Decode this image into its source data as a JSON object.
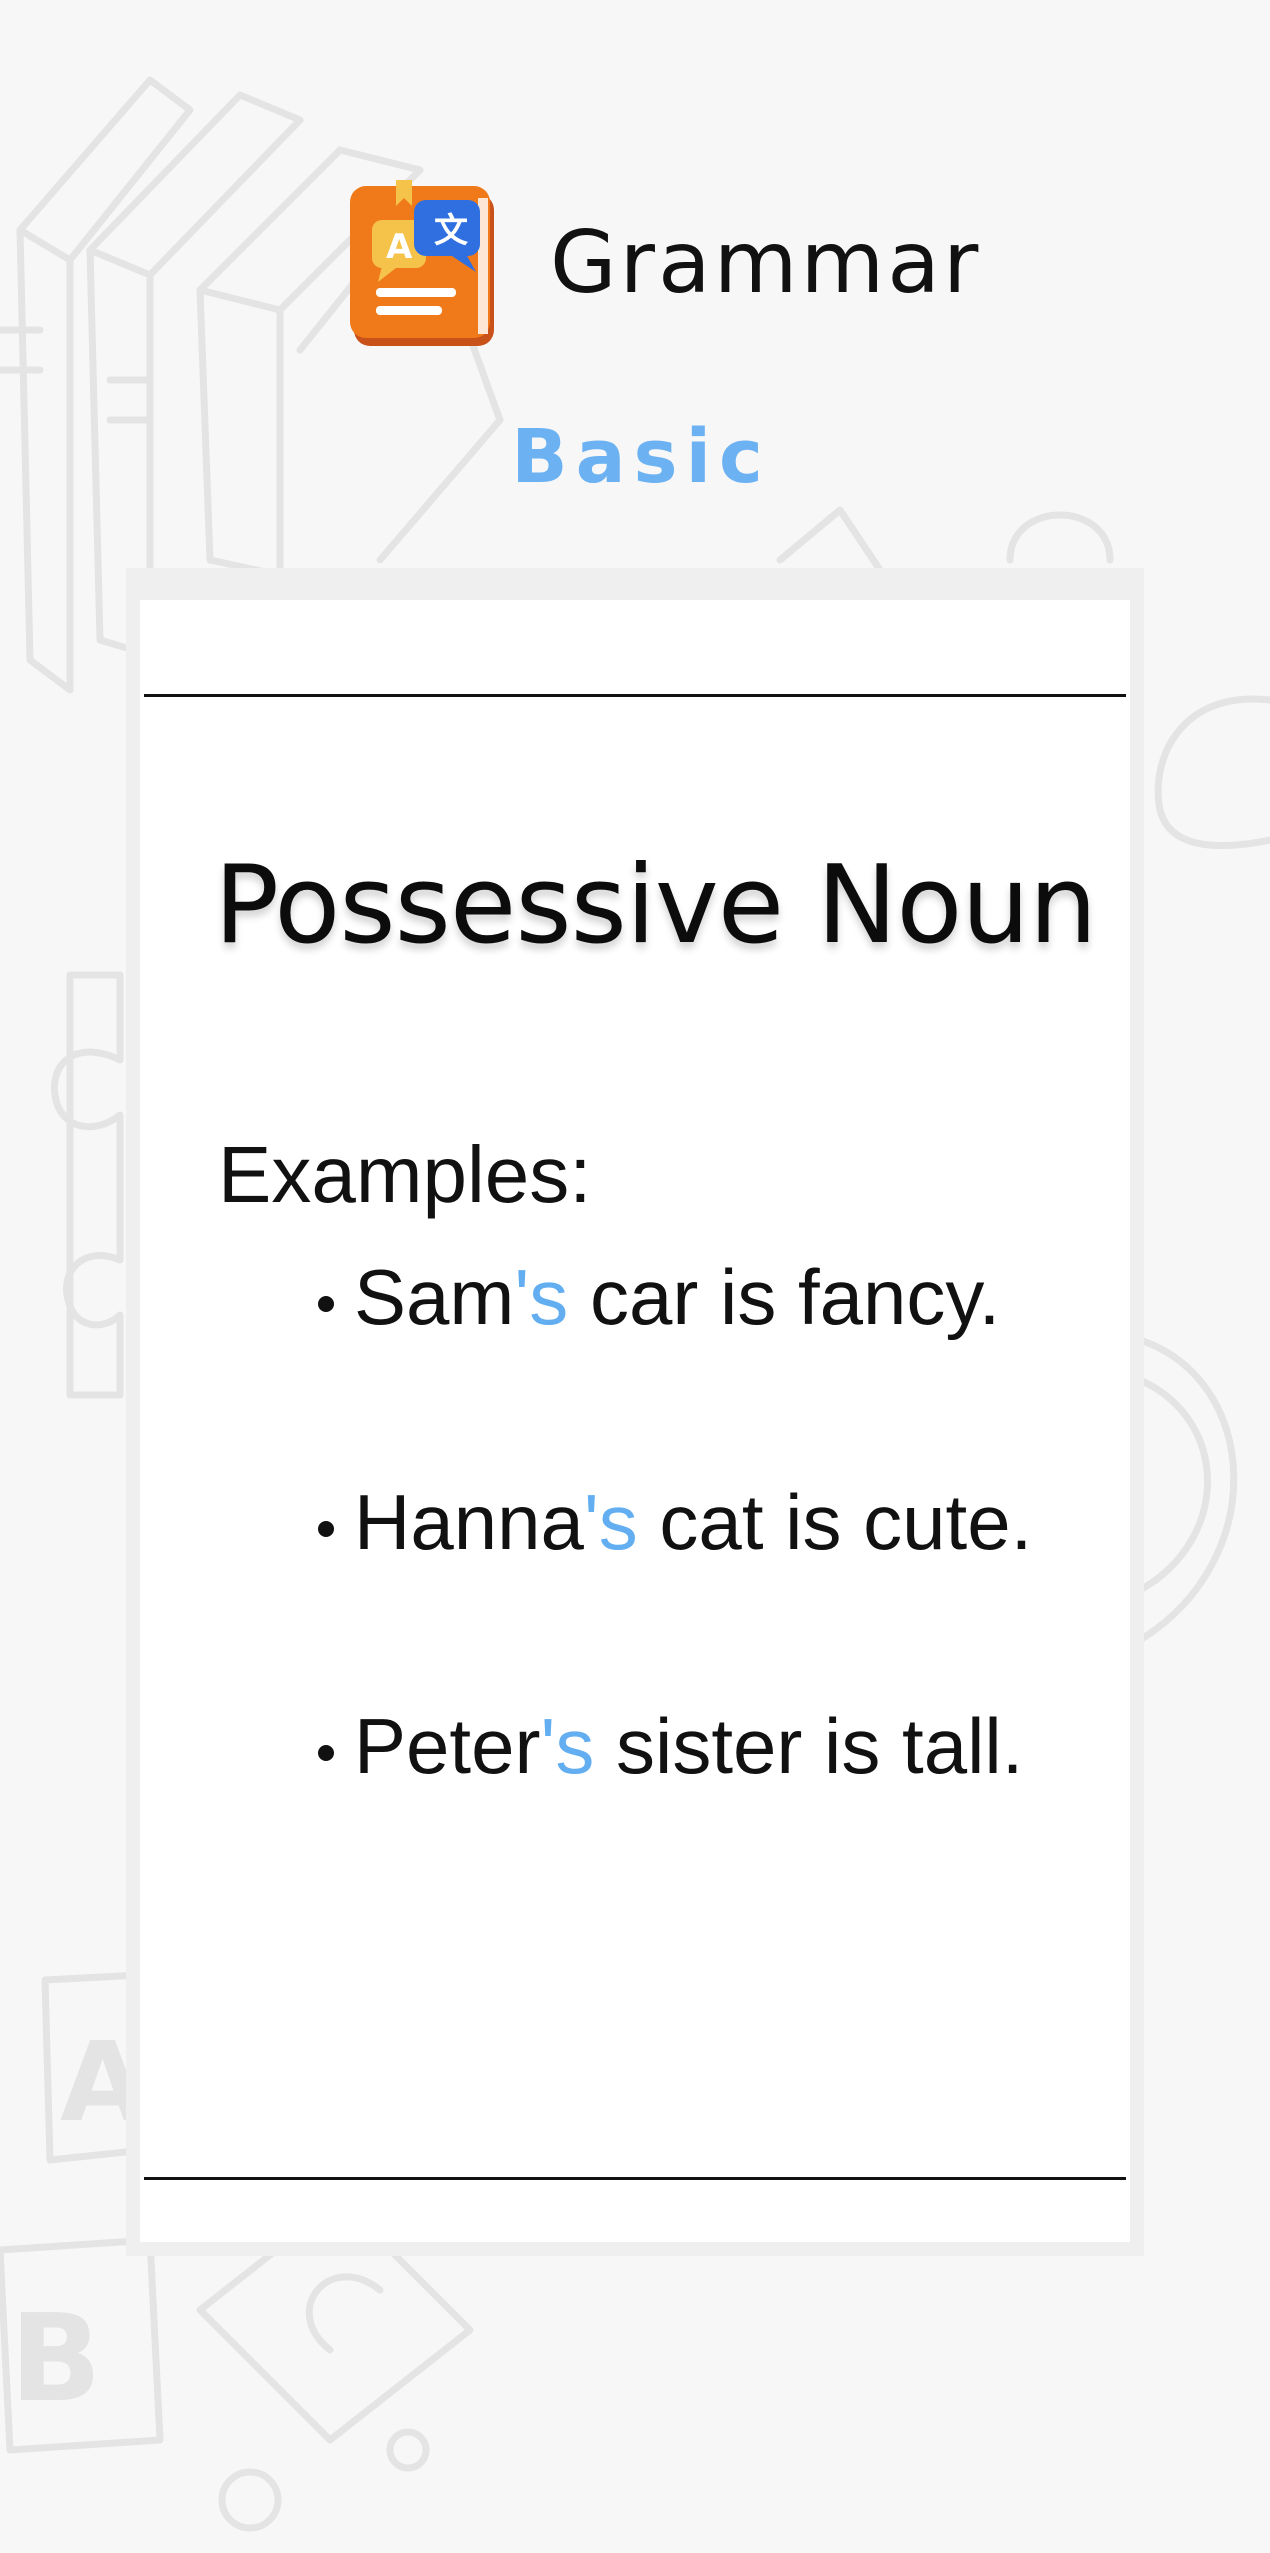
{
  "app": {
    "title": "Grammar",
    "level": "Basic",
    "logo_icon": "translation-book-icon"
  },
  "lesson": {
    "title": "Possessive Noun",
    "examples_label": "Examples:",
    "examples": [
      {
        "owner": "Sam",
        "suffix": "'s",
        "rest": " car is fancy."
      },
      {
        "owner": "Hanna",
        "suffix": "'s",
        "rest": " cat is cute."
      },
      {
        "owner": "Peter",
        "suffix": "'s",
        "rest": " sister is tall."
      }
    ]
  },
  "colors": {
    "accent": "#62aef0",
    "level": "#6cb2f2",
    "text": "#111111",
    "background": "#f7f7f7",
    "card": "#ffffff",
    "logo_orange": "#f07a1a",
    "logo_blue": "#2f6fe0",
    "logo_yellow": "#f5c24a"
  }
}
